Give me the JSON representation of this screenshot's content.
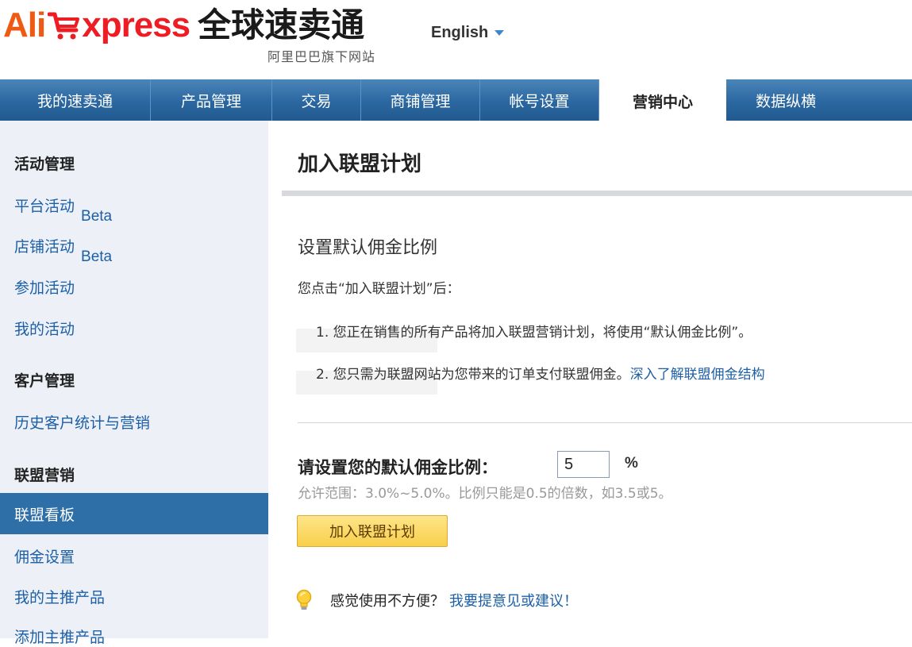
{
  "header": {
    "logo_ali": "Ali",
    "logo_xpress": "xpress",
    "logo_cn": "全球速卖通",
    "logo_sub": "阿里巴巴旗下网站",
    "language": "English",
    "brand_colors": {
      "orange": "#ee5a12",
      "red": "#ee1d24"
    }
  },
  "nav": {
    "items": [
      {
        "label": "我的速卖通"
      },
      {
        "label": "产品管理"
      },
      {
        "label": "交易"
      },
      {
        "label": "商铺管理"
      },
      {
        "label": "帐号设置"
      },
      {
        "label": "营销中心",
        "active": true
      },
      {
        "label": "数据纵横"
      }
    ]
  },
  "sidebar": {
    "sections": [
      {
        "title": "活动管理",
        "items": [
          {
            "label": "平台活动",
            "badge": "Beta"
          },
          {
            "label": "店铺活动",
            "badge": "Beta"
          },
          {
            "label": "参加活动"
          },
          {
            "label": "我的活动"
          }
        ]
      },
      {
        "title": "客户管理",
        "items": [
          {
            "label": "历史客户统计与营销"
          }
        ]
      },
      {
        "title": "联盟营销",
        "items": [
          {
            "label": "联盟看板",
            "active": true
          },
          {
            "label": "佣金设置"
          },
          {
            "label": "我的主推产品"
          },
          {
            "label": "添加主推产品"
          }
        ]
      }
    ]
  },
  "main": {
    "title": "加入联盟计划",
    "section_title": "设置默认佣金比例",
    "intro": "您点击“加入联盟计划”后：",
    "list": [
      {
        "text": "1. 您正在销售的所有产品将加入联盟营销计划，将使用“默认佣金比例”。"
      },
      {
        "text": "2. 您只需为联盟网站为您带来的订单支付联盟佣金。",
        "link": "深入了解联盟佣金结构"
      }
    ],
    "rate_label": "请设置您的默认佣金比例：",
    "rate_value": "5",
    "rate_unit": "%",
    "hint": "允许范围：3.0%~5.0%。比例只能是0.5的倍数，如3.5或5。",
    "join_button": "加入联盟计划",
    "feedback_text": "感觉使用不方便？",
    "feedback_link": "我要提意见或建议！"
  },
  "colors": {
    "nav": "#2b67a0",
    "sidebar_bg": "#edf1f7",
    "link": "#1c5fa7",
    "button": "#f9cf4a"
  },
  "icons": {
    "cart": "cart-icon",
    "language_caret": "chevron-down-icon",
    "feedback": "lightbulb-icon"
  }
}
